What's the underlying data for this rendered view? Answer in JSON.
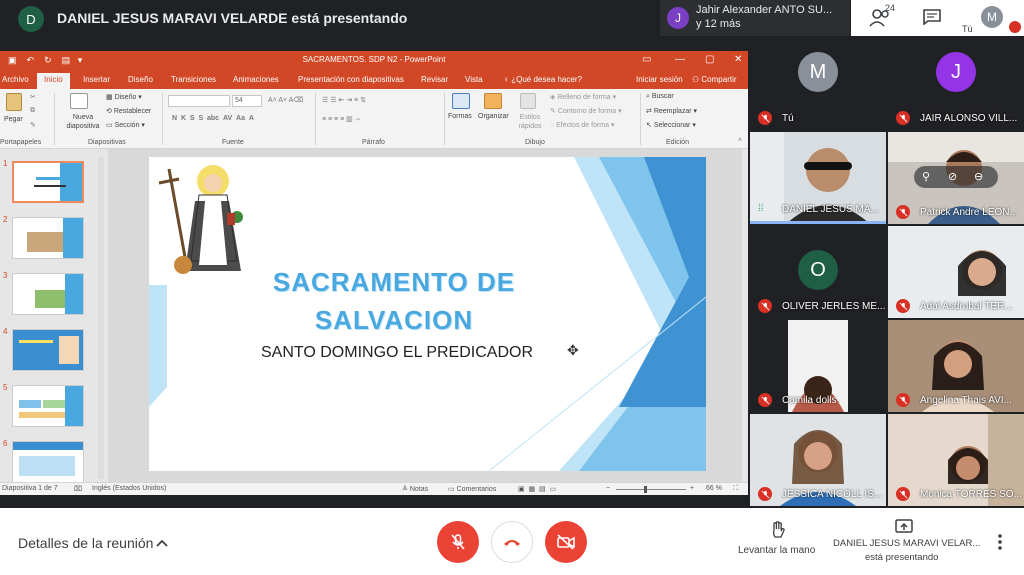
{
  "topbar": {
    "presenter_initial": "D",
    "presenter_title": "DANIEL JESUS MARAVI VELARDE está presentando",
    "others_initial": "J",
    "others_line1": "Jahir Alexander ANTO SU...",
    "others_line2": "y 12 más",
    "participant_count": "24",
    "self_initial": "M",
    "self_label": "Tú"
  },
  "ppt": {
    "title": "SACRAMENTOS. SDP N2 - PowerPoint",
    "tabs": [
      "Archivo",
      "Inicio",
      "Insertar",
      "Diseño",
      "Transiciones",
      "Animaciones",
      "Presentación con diapositivas",
      "Revisar",
      "Vista",
      "¿Qué desea hacer?"
    ],
    "signin": "Iniciar sesión",
    "share": "Compartir",
    "ribbon": {
      "paste": "Pegar",
      "new_slide": "Nueva diapositiva",
      "layout": "Diseño",
      "reset": "Restablecer",
      "section": "Sección",
      "font_size": "54",
      "shapes": "Formas",
      "arrange": "Organizar",
      "quick_styles": "Estilos rápidos",
      "shape_fill": "Relleno de forma",
      "shape_outline": "Contorno de forma",
      "shape_effects": "Efectos de forma",
      "find": "Buscar",
      "replace": "Reemplazar",
      "select": "Seleccionar",
      "group_clipboard": "Portapapeles",
      "group_slides": "Diapositivas",
      "group_font": "Fuente",
      "group_paragraph": "Párrafo",
      "group_drawing": "Dibujo",
      "group_editing": "Edición"
    },
    "thumb_numbers": [
      "1",
      "2",
      "3",
      "4",
      "5",
      "6"
    ],
    "slide_title_line1": "SACRAMENTO DE",
    "slide_title_line2": "SALVACION",
    "slide_subtitle": "SANTO DOMINGO EL PREDICADOR",
    "status": {
      "slide_info": "Diapositiva 1 de 7",
      "language": "Inglés (Estados Unidos)",
      "notes": "Notas",
      "comments": "Comentarios",
      "zoom": "66 %"
    }
  },
  "tiles": [
    {
      "name": "Tú",
      "initial": "M",
      "color": "#8a9099"
    },
    {
      "name": "JAIR ALONSO VILL...",
      "initial": "J",
      "color": "#9334e6"
    },
    {
      "name": "DANIEL JESUS MA..."
    },
    {
      "name": "Patrick Andre LEON..."
    },
    {
      "name": "OLIVER JERLES ME...",
      "initial": "O",
      "color": "#1e5f46"
    },
    {
      "name": "Adal Asdrubal TER..."
    },
    {
      "name": "Camila dolls"
    },
    {
      "name": "Angelina Thais AVI..."
    },
    {
      "name": "JESSICA NICOLL IS..."
    },
    {
      "name": "Monica TORRES SO..."
    }
  ],
  "bottombar": {
    "details": "Detalles de la reunión",
    "raise_hand": "Levantar la mano",
    "presenting_line1": "DANIEL JESUS MARAVI VELAR...",
    "presenting_line2": "está presentando"
  },
  "colors": {
    "ppt_accent": "#d24726",
    "meet_red": "#ea4335",
    "slide_title_blue": "#4aa8e0"
  }
}
